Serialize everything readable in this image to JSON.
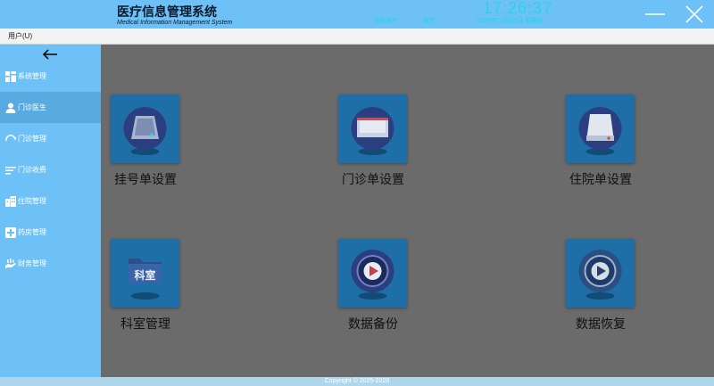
{
  "header": {
    "title": "医疗信息管理系统",
    "subtitle": "Medical Information Management System",
    "user": "当前用户：",
    "role": "医生",
    "time": "17:26:37",
    "date": "2025年12月05日 星期五"
  },
  "menubar": {
    "user_menu": "用户(U)"
  },
  "sidebar": {
    "items": [
      {
        "label": "系统管理",
        "icon": "dashboard-icon"
      },
      {
        "label": "门诊医生",
        "icon": "person-icon"
      },
      {
        "label": "门诊管理",
        "icon": "refresh-icon"
      },
      {
        "label": "门诊收费",
        "icon": "list-icon"
      },
      {
        "label": "住院管理",
        "icon": "building-icon"
      },
      {
        "label": "药房管理",
        "icon": "medical-plus-icon"
      },
      {
        "label": "财务管理",
        "icon": "hand-money-icon"
      }
    ],
    "active_index": 1
  },
  "tiles": [
    {
      "label": "挂号单设置"
    },
    {
      "label": "门诊单设置"
    },
    {
      "label": "住院单设置"
    },
    {
      "label": "科室管理",
      "badge": "科室"
    },
    {
      "label": "数据备份"
    },
    {
      "label": "数据恢复"
    }
  ],
  "footer": {
    "copyright": "Copyright © 2025-2028"
  },
  "colors": {
    "accent": "#6ec1f6",
    "active": "#58abe1",
    "tile": "#1e6fa8",
    "content_bg": "#6b6b6b"
  }
}
